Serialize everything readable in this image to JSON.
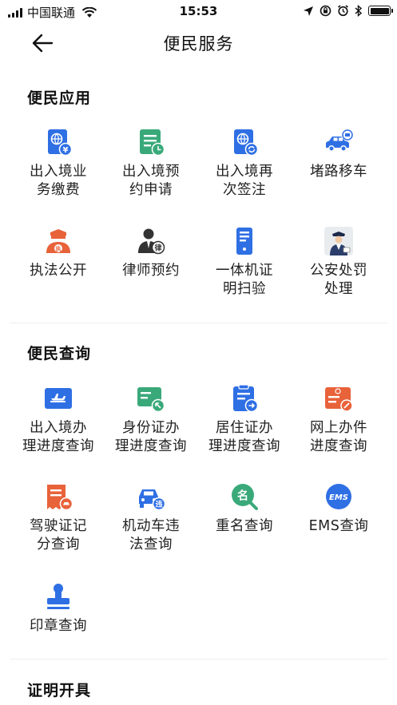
{
  "status_bar": {
    "carrier": "中国联通",
    "time": "15:53"
  },
  "nav": {
    "title": "便民服务"
  },
  "sections": [
    {
      "title": "便民应用",
      "items": [
        {
          "label1": "出入境业",
          "label2": "务缴费",
          "icon": "passport-yen-icon"
        },
        {
          "label1": "出入境预",
          "label2": "约申请",
          "icon": "document-clock-icon"
        },
        {
          "label1": "出入境再",
          "label2": "次签注",
          "icon": "passport-refresh-icon"
        },
        {
          "label1": "堵路移车",
          "label2": "",
          "icon": "car-move-icon"
        },
        {
          "label1": "执法公开",
          "label2": "",
          "icon": "police-officer-icon"
        },
        {
          "label1": "律师预约",
          "label2": "",
          "icon": "lawyer-icon"
        },
        {
          "label1": "一体机证",
          "label2": "明扫验",
          "icon": "kiosk-icon"
        },
        {
          "label1": "公安处罚",
          "label2": "处理",
          "icon": "police-penalty-icon"
        }
      ]
    },
    {
      "title": "便民查询",
      "items": [
        {
          "label1": "出入境办",
          "label2": "理进度查询",
          "icon": "flight-progress-icon"
        },
        {
          "label1": "身份证办",
          "label2": "理进度查询",
          "icon": "id-card-progress-icon"
        },
        {
          "label1": "居住证办",
          "label2": "理进度查询",
          "icon": "residence-permit-icon"
        },
        {
          "label1": "网上办件",
          "label2": "进度查询",
          "icon": "online-case-icon"
        },
        {
          "label1": "驾驶证记",
          "label2": "分查询",
          "icon": "driver-license-icon"
        },
        {
          "label1": "机动车违",
          "label2": "法查询",
          "icon": "vehicle-violation-icon"
        },
        {
          "label1": "重名查询",
          "label2": "",
          "icon": "name-search-icon"
        },
        {
          "label1": "EMS查询",
          "label2": "",
          "icon": "ems-icon"
        },
        {
          "label1": "印章查询",
          "label2": "",
          "icon": "seal-icon"
        }
      ]
    },
    {
      "title": "证明开具",
      "items": []
    }
  ],
  "colors": {
    "blue": "#2f6fe4",
    "green": "#3aa97a",
    "orange": "#e8623a"
  }
}
